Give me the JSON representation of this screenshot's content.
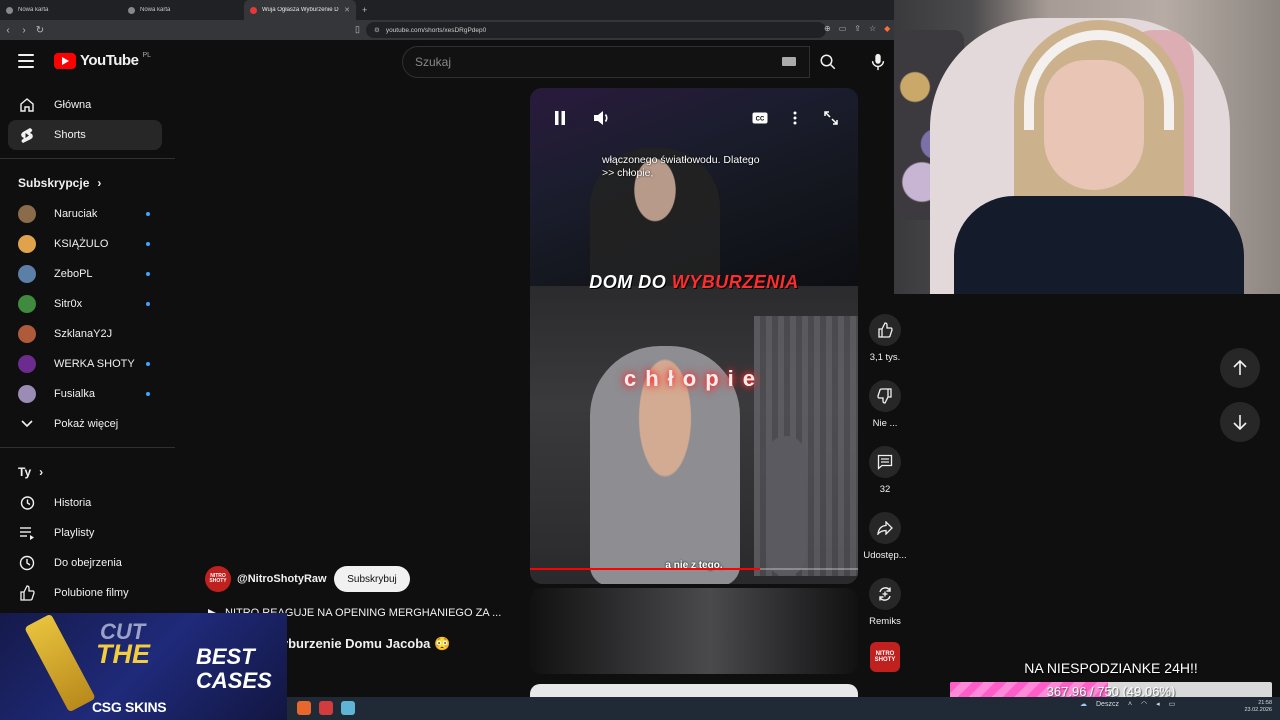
{
  "browser": {
    "tabs": [
      {
        "title": "Nowa karta"
      },
      {
        "title": "Nowa karta"
      },
      {
        "title": "Wuja Ogłasza Wyburzenie D..."
      }
    ],
    "url": "youtube.com/shorts/xesDRgPdep0"
  },
  "youtube": {
    "logo_text": "YouTube",
    "country_code": "PL",
    "search_placeholder": "Szukaj"
  },
  "sidebar": {
    "main": [
      {
        "label": "Główna",
        "icon": "home-icon"
      },
      {
        "label": "Shorts",
        "icon": "shorts-icon",
        "active": true
      }
    ],
    "subs_heading": "Subskrypcje",
    "subscriptions": [
      {
        "label": "Naruciak",
        "color": "#8a6b4a"
      },
      {
        "label": "KSIĄŻULO",
        "color": "#e0a24a"
      },
      {
        "label": "ZeboPL",
        "color": "#5c7fa8"
      },
      {
        "label": "Sitr0x",
        "color": "#3f8a3c"
      },
      {
        "label": "SzklanaY2J",
        "color": "#b05a3c"
      },
      {
        "label": "WERKA SHOTY",
        "color": "#6b2b8f"
      },
      {
        "label": "Fusialka",
        "color": "#9a8cb4"
      }
    ],
    "show_more": "Pokaż więcej",
    "you_heading": "Ty",
    "you_items": [
      {
        "label": "Historia",
        "icon": "history-icon"
      },
      {
        "label": "Playlisty",
        "icon": "playlist-icon"
      },
      {
        "label": "Do obejrzenia",
        "icon": "clock-icon"
      },
      {
        "label": "Polubione filmy",
        "icon": "thumbs-up-icon"
      }
    ]
  },
  "short": {
    "caption_top": "włączonego światłowodu. Dlatego",
    "caption_top2": ">> chłopie,",
    "banner_white": "DOM DO ",
    "banner_red": "WYBURZENIA",
    "overlay_word": "chłopie",
    "caption_bottom": "a nie z tego,",
    "progress": 0.7
  },
  "video_info": {
    "channel_avatar_text": "NITRO SHOTY",
    "channel": "@NitroShotyRaw",
    "subscribe": "Subskrybuj",
    "playlist_line": "NITRO REAGUJE NA OPENING MERGHANIEGO ZA ...",
    "title": "a Wyburzenie Domu Jacoba 😳"
  },
  "actions": {
    "like_count": "3,1 tys.",
    "dislike": "Nie ...",
    "comments": "32",
    "share": "Udostęp...",
    "remix": "Remiks"
  },
  "overlays": {
    "ad_text_top": "CUT",
    "ad_the": "THE",
    "ad_best": "BEST",
    "ad_cases": "CASES",
    "ad_brand": "CSG SKINS",
    "goal_title": "NA NIESPODZIANKE 24H!!",
    "goal_text": "367.96 / 750 (49.06%)",
    "goal_fraction": 0.4906
  },
  "taskbar": {
    "weather": "Deszcz",
    "time": "21:58",
    "date": "23.02.2026"
  }
}
